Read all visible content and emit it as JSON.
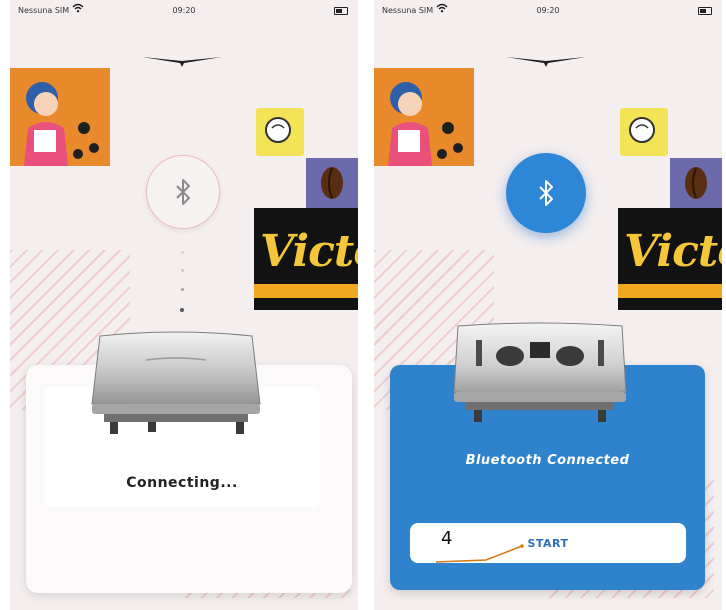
{
  "status_bar": {
    "carrier": "Nessuna SIM",
    "time": "09:20"
  },
  "screens": [
    {
      "state": "connecting",
      "message": "Connecting..."
    },
    {
      "state": "connected",
      "message": "Bluetooth Connected",
      "start_label": "START"
    }
  ],
  "banner": {
    "text": "Victori"
  },
  "annotation": {
    "number": "4"
  },
  "colors": {
    "background": "#f4eeee",
    "accent_blue": "#2f82cc",
    "bluetooth_blue": "#2d86d6",
    "text_blue": "#2f6fb8"
  },
  "icons": {
    "bluetooth": "bluetooth-icon",
    "wifi": "wifi-icon",
    "battery": "battery-icon"
  }
}
